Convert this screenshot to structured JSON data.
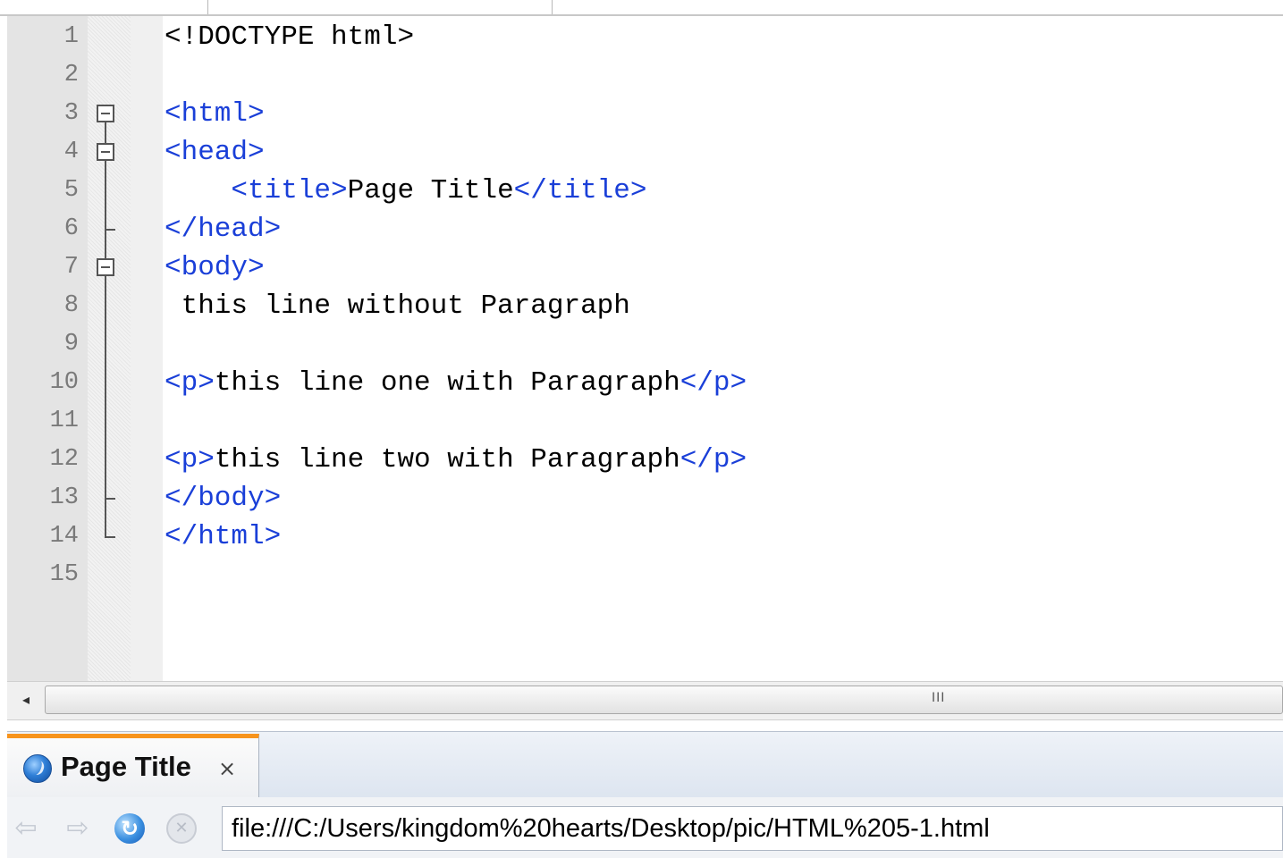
{
  "editor": {
    "lines": [
      {
        "num": "1",
        "segments": [
          {
            "text": "<!DOCTYPE html>",
            "kind": "plain"
          }
        ]
      },
      {
        "num": "2",
        "segments": []
      },
      {
        "num": "3",
        "segments": [
          {
            "text": "<html>",
            "kind": "tag"
          }
        ]
      },
      {
        "num": "4",
        "segments": [
          {
            "text": "<head>",
            "kind": "tag"
          }
        ]
      },
      {
        "num": "5",
        "segments": [
          {
            "text": "    <title>",
            "kind": "tag"
          },
          {
            "text": "Page Title",
            "kind": "plain"
          },
          {
            "text": "</title>",
            "kind": "tag"
          }
        ]
      },
      {
        "num": "6",
        "segments": [
          {
            "text": "</head>",
            "kind": "tag"
          }
        ]
      },
      {
        "num": "7",
        "segments": [
          {
            "text": "<body>",
            "kind": "tag"
          }
        ]
      },
      {
        "num": "8",
        "segments": [
          {
            "text": " this line without Paragraph",
            "kind": "plain"
          }
        ]
      },
      {
        "num": "9",
        "segments": []
      },
      {
        "num": "10",
        "segments": [
          {
            "text": "<p>",
            "kind": "tag"
          },
          {
            "text": "this line one with Paragraph",
            "kind": "plain"
          },
          {
            "text": "</p>",
            "kind": "tag"
          }
        ]
      },
      {
        "num": "11",
        "segments": []
      },
      {
        "num": "12",
        "segments": [
          {
            "text": "<p>",
            "kind": "tag"
          },
          {
            "text": "this line two with Paragraph",
            "kind": "plain"
          },
          {
            "text": "</p>",
            "kind": "tag"
          }
        ]
      },
      {
        "num": "13",
        "segments": [
          {
            "text": "</body>",
            "kind": "tag"
          }
        ]
      },
      {
        "num": "14",
        "segments": [
          {
            "text": "</html>",
            "kind": "tag"
          }
        ]
      },
      {
        "num": "15",
        "segments": []
      }
    ],
    "fold_markers": [
      {
        "line": 3,
        "type": "box"
      },
      {
        "line": 4,
        "type": "box"
      },
      {
        "line": 6,
        "type": "tick"
      },
      {
        "line": 7,
        "type": "box"
      },
      {
        "line": 13,
        "type": "tick"
      },
      {
        "line": 14,
        "type": "end"
      }
    ],
    "colors": {
      "tag": "#1a3fd8",
      "text": "#000000",
      "line_number": "#7a7a7a"
    }
  },
  "scrollbar": {
    "left_arrow_icon": "◂",
    "grip": "III"
  },
  "browser": {
    "tab": {
      "title": "Page Title",
      "close": "×",
      "favicon": "page-globe-icon",
      "accent_color": "#f7941d"
    },
    "nav": {
      "back_icon": "⇦",
      "forward_icon": "⇨",
      "reload_icon": "↻",
      "stop_icon": "✕"
    },
    "address": "file:///C:/Users/kingdom%20hearts/Desktop/pic/HTML%205-1.html"
  }
}
